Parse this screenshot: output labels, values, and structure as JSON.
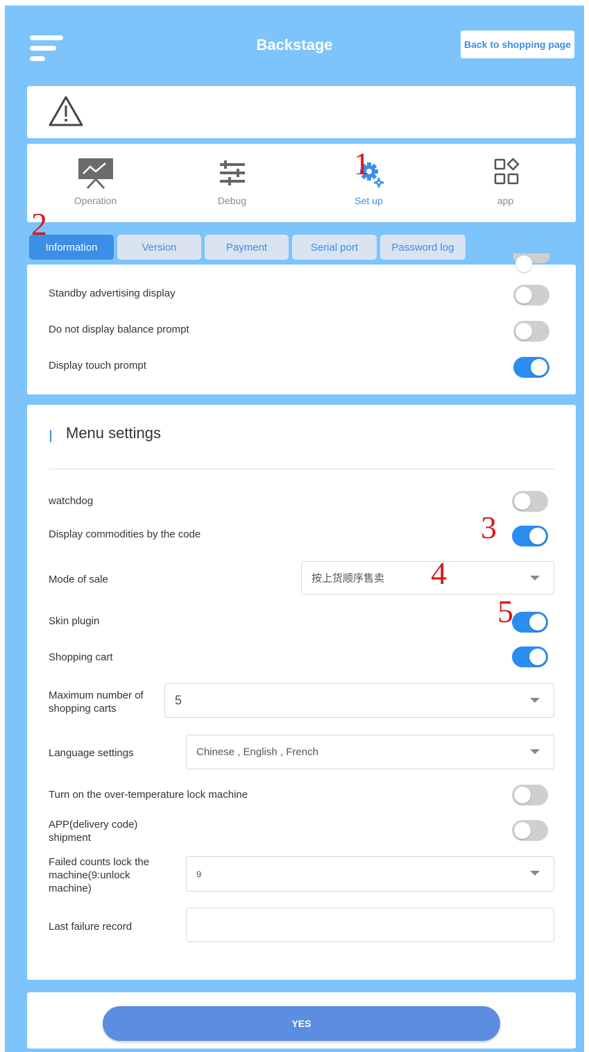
{
  "header": {
    "title": "Backstage",
    "back_label": "Back to shopping page"
  },
  "nav": [
    {
      "label": "Operation",
      "icon": "presentation-board-icon"
    },
    {
      "label": "Debug",
      "icon": "sliders-icon"
    },
    {
      "label": "Set up",
      "icon": "gears-icon",
      "active": true
    },
    {
      "label": "app",
      "icon": "app-grid-icon"
    }
  ],
  "annotations": {
    "n1": "1",
    "n2": "2",
    "n3": "3",
    "n4": "4",
    "n5": "5"
  },
  "tabs": [
    "Information",
    "Version",
    "Payment",
    "Serial port",
    "Password log"
  ],
  "active_tab": "Information",
  "display_settings": [
    {
      "label": "Standby advertising display",
      "on": false
    },
    {
      "label": "Do not display balance prompt",
      "on": false
    },
    {
      "label": "Display touch prompt",
      "on": true
    }
  ],
  "menu": {
    "title": "Menu settings",
    "watchdog": {
      "label": "watchdog",
      "on": false
    },
    "display_by_code": {
      "label": "Display commodities by the code",
      "on": true
    },
    "mode_of_sale": {
      "label": "Mode of sale",
      "value": "按上货顺序售卖"
    },
    "skin_plugin": {
      "label": "Skin plugin",
      "on": true
    },
    "shopping_cart": {
      "label": "Shopping cart",
      "on": true
    },
    "max_carts": {
      "label": "Maximum number of shopping carts",
      "value": "5"
    },
    "language": {
      "label": "Language settings",
      "value": "Chinese , English , French"
    },
    "over_temp": {
      "label": "Turn on the over-temperature lock machine",
      "on": false
    },
    "app_shipment": {
      "label": "APP(delivery code) shipment",
      "on": false
    },
    "failed_counts": {
      "label": "Failed counts lock the machine(9:unlock machine)",
      "value": "9"
    },
    "last_failure": {
      "label": "Last failure record",
      "value": ""
    }
  },
  "footer": {
    "yes_label": "YES"
  },
  "colors": {
    "background": "#7cc4fb",
    "accent": "#3c8ee6",
    "toggle_on": "#2b8df0",
    "annotation": "#d91b1b"
  }
}
